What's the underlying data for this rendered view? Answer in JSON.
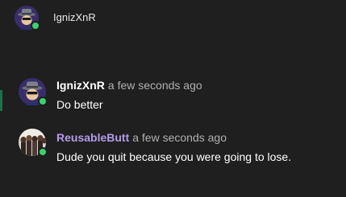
{
  "header": {
    "username": "IgnizXnR",
    "avatar_icon": "cowboy-hat-avatar-icon",
    "presence": "online"
  },
  "messages": [
    {
      "author": "IgnizXnR",
      "author_color": "#ffffff",
      "timestamp": "a few seconds ago",
      "text": "Do better",
      "avatar_icon": "cowboy-hat-avatar-icon",
      "presence": "online"
    },
    {
      "author": "ReusableButt",
      "author_color": "#b49be8",
      "timestamp": "a few seconds ago",
      "text": "Dude you quit because you were going to lose.",
      "avatar_icon": "group-photo-avatar-icon",
      "presence": "online"
    }
  ],
  "colors": {
    "background": "#1f1f1f",
    "online": "#3bd16f",
    "timestamp": "#b0b0b0"
  }
}
